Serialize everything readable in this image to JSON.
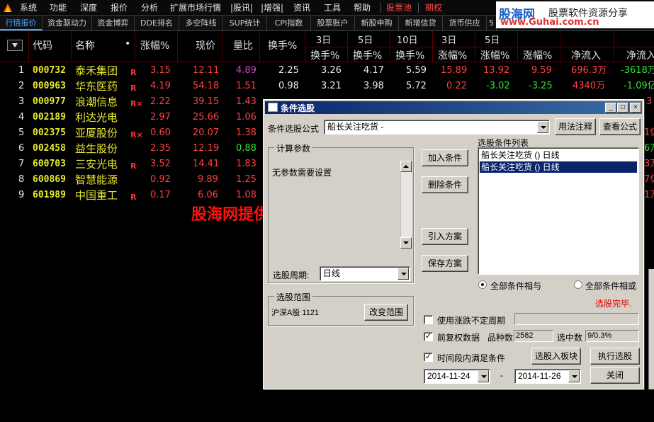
{
  "menu": [
    "系统",
    "功能",
    "深度",
    "报价",
    "分析",
    "扩展市场行情",
    "|股讯|",
    "|增强|",
    "资讯",
    "工具",
    "帮助",
    "股票池",
    "期权"
  ],
  "tabs": [
    "行情报价",
    "资金驱动力",
    "资金博弈",
    "DDE排名",
    "多空阵线",
    "SUP统计",
    "CPI指数",
    "股票账户",
    "新股申购",
    "新增信贷",
    "货币供应",
    "5"
  ],
  "site_banner": {
    "brand": "股海网",
    "slogan": "股票软件资源分享",
    "url": "www.Guhai.com.cn"
  },
  "table": {
    "headers": {
      "code": "代码",
      "name": "名称",
      "name_marker": "•",
      "change": "涨幅%",
      "price": "现价",
      "vol_ratio": "量比",
      "turnover": "换手%",
      "d3": "3日",
      "d5": "5日",
      "d10": "10日",
      "d3b": "3日",
      "d5b": "5日",
      "turnover3": "换手%",
      "turnover5": "换手%",
      "turnover10": "换手%",
      "change3": "涨幅%",
      "change5": "涨幅%",
      "change10": "涨幅%",
      "netflow": "净流入",
      "netflow2": "净流入"
    },
    "rows": [
      {
        "idx": "1",
        "code": "000732",
        "name": "泰禾集团",
        "flag": "R",
        "change": "3.15",
        "price": "12.11",
        "vol": "4.89",
        "t": "2.25",
        "t3": "3.26",
        "t5": "4.17",
        "t10": "5.59",
        "c3": "15.89",
        "c5": "13.92",
        "c10": "9.59",
        "nf": "696.3万",
        "nf2": "-3618万"
      },
      {
        "idx": "2",
        "code": "000963",
        "name": "华东医药",
        "flag": "R",
        "change": "4.19",
        "price": "54.18",
        "vol": "1.51",
        "t": "0.98",
        "t3": "3.21",
        "t5": "3.98",
        "t10": "5.72",
        "c3": "0.22",
        "c5": "-3.02",
        "c10": "-3.25",
        "nf": "4340万",
        "nf2": "-1.09亿"
      },
      {
        "idx": "3",
        "code": "000977",
        "name": "浪潮信息",
        "flag": "R×",
        "change": "2.22",
        "price": "39.15",
        "vol": "1.43",
        "t": "",
        "t3": "",
        "t5": "",
        "t10": "",
        "c3": "",
        "c5": "",
        "c10": "",
        "nf": "",
        "nf2": ""
      },
      {
        "idx": "4",
        "code": "002189",
        "name": "利达光电",
        "flag": "",
        "change": "2.97",
        "price": "25.66",
        "vol": "1.06",
        "t": "",
        "t3": "",
        "t5": "",
        "t10": "",
        "c3": "",
        "c5": "",
        "c10": "",
        "nf": "",
        "nf2": ""
      },
      {
        "idx": "5",
        "code": "002375",
        "name": "亚厦股份",
        "flag": "R×",
        "change": "0.60",
        "price": "20.07",
        "vol": "1.38",
        "t": "",
        "t3": "",
        "t5": "",
        "t10": "",
        "c3": "",
        "c5": "",
        "c10": "",
        "nf": "",
        "nf2": ""
      },
      {
        "idx": "6",
        "code": "002458",
        "name": "益生股份",
        "flag": "",
        "change": "2.35",
        "price": "12.19",
        "vol": "0.88",
        "t": "",
        "t3": "",
        "t5": "",
        "t10": "",
        "c3": "",
        "c5": "",
        "c10": "",
        "nf": "",
        "nf2": ""
      },
      {
        "idx": "7",
        "code": "600703",
        "name": "三安光电",
        "flag": "R",
        "change": "3.52",
        "price": "14.41",
        "vol": "1.83",
        "t": "",
        "t3": "",
        "t5": "",
        "t10": "",
        "c3": "",
        "c5": "",
        "c10": "",
        "nf": "",
        "nf2": ""
      },
      {
        "idx": "8",
        "code": "600869",
        "name": "智慧能源",
        "flag": "",
        "change": "0.92",
        "price": "9.89",
        "vol": "1.25",
        "t": "",
        "t3": "",
        "t5": "",
        "t10": "",
        "c3": "",
        "c5": "",
        "c10": "",
        "nf": "",
        "nf2": ""
      },
      {
        "idx": "9",
        "code": "601989",
        "name": "中国重工",
        "flag": "R",
        "change": "0.17",
        "price": "6.06",
        "vol": "1.08",
        "t": "",
        "t3": "",
        "t5": "",
        "t10": "",
        "c3": "",
        "c5": "",
        "c10": "",
        "nf": "",
        "nf2": ""
      }
    ],
    "right_edge_values": [
      "3",
      "1亿",
      "6万",
      "3万",
      "7亿",
      "1万"
    ]
  },
  "watermark": "股海网提供 Www.Guhai.Com.CN",
  "dialog": {
    "title": "条件选股",
    "formula_label": "条件选股公式",
    "formula_value": "船长关注吃货 -",
    "btn_usage": "用法注释",
    "btn_view_formula": "查看公式",
    "params_group": "计算参数",
    "params_text": "无参数需要设置",
    "btn_add": "加入条件",
    "btn_delete": "删除条件",
    "btn_import": "引入方案",
    "btn_save": "保存方案",
    "list_title": "选股条件列表",
    "list_items": [
      "船长关注吃货  () 日线",
      "船长关注吃货  () 日线"
    ],
    "radio_and": "全部条件相与",
    "radio_or": "全部条件相或",
    "period_label": "选股周期:",
    "period_value": "日线",
    "status": "选股完毕.",
    "range_group": "选股范围",
    "range_value": "沪深A股 1121",
    "btn_change_range": "改变范围",
    "use_uncertain": "使用涨跌不定周期",
    "pre_adjust": "前复权数据",
    "count_label": "品种数",
    "count_value": "2582",
    "selected_label": "选中数",
    "selected_value": "9/0.3%",
    "time_satisfy": "时间段内满足条件",
    "btn_to_block": "选股入板块",
    "btn_execute": "执行选股",
    "date_from": "2014-11-24",
    "date_sep": "-",
    "date_to": "2014-11-26",
    "btn_close": "关闭"
  }
}
